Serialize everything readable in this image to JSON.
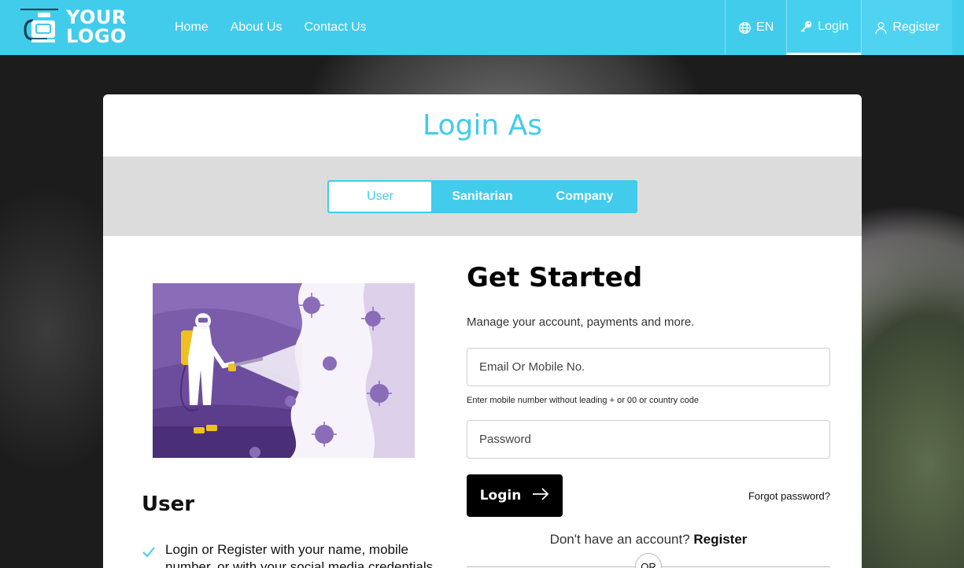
{
  "header": {
    "logo_line1": "YOUR",
    "logo_line2": "LOGO",
    "nav": [
      "Home",
      "About Us",
      "Contact Us"
    ],
    "language": "EN",
    "login": "Login",
    "register": "Register"
  },
  "card": {
    "title": "Login As",
    "tabs": [
      "User",
      "Sanitarian",
      "Company"
    ],
    "active_tab": "User"
  },
  "left": {
    "heading": "User",
    "benefit": "Login or Register with your name, mobile number, or with your social media credentials"
  },
  "form": {
    "title": "Get Started",
    "subtitle": "Manage your account, payments and more.",
    "email_placeholder": "Email Or Mobile No.",
    "hint": "Enter mobile number without leading + or 00 or country code",
    "password_placeholder": "Password",
    "login_button": "Login",
    "forgot": "Forgot password?",
    "no_account": "Don't have an account?",
    "register_link": "Register",
    "or": "OR"
  },
  "colors": {
    "accent": "#41ccec",
    "band": "#dcdcdc",
    "illustration": "#7a5aa6"
  },
  "icons": [
    "globe-icon",
    "key-icon",
    "user-icon",
    "arrow-right-icon",
    "check-icon"
  ]
}
